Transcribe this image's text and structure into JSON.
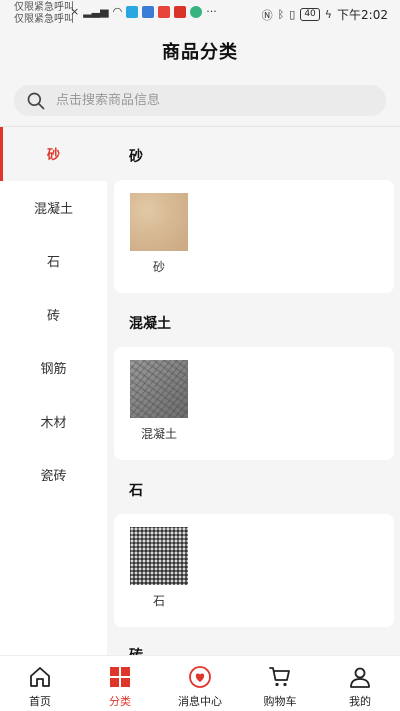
{
  "status_bar": {
    "carrier_line1": "仅限紧急呼叫",
    "carrier_line2": "仅限紧急呼叫",
    "battery": "40",
    "time": "下午2:02"
  },
  "header": {
    "title": "商品分类"
  },
  "search": {
    "placeholder": "点击搜索商品信息"
  },
  "sidebar": {
    "items": [
      {
        "label": "砂",
        "active": true
      },
      {
        "label": "混凝土"
      },
      {
        "label": "石"
      },
      {
        "label": "砖"
      },
      {
        "label": "钢筋"
      },
      {
        "label": "木材"
      },
      {
        "label": "瓷砖"
      }
    ]
  },
  "content": {
    "sections": [
      {
        "title": "砂",
        "products": [
          {
            "name": "砂",
            "image": "sand-photo"
          }
        ]
      },
      {
        "title": "混凝土",
        "products": [
          {
            "name": "混凝土",
            "image": "concrete-photo"
          }
        ]
      },
      {
        "title": "石",
        "products": [
          {
            "name": "石",
            "image": "stone-photo"
          }
        ]
      },
      {
        "title": "砖",
        "products": []
      }
    ]
  },
  "bottom_nav": {
    "items": [
      {
        "label": "首页",
        "icon": "home-icon"
      },
      {
        "label": "分类",
        "icon": "category-icon",
        "active": true
      },
      {
        "label": "消息中心",
        "icon": "message-heart-icon"
      },
      {
        "label": "购物车",
        "icon": "cart-icon"
      },
      {
        "label": "我的",
        "icon": "user-icon"
      }
    ]
  },
  "colors": {
    "accent": "#e0352b",
    "background": "#f5f5f5",
    "text": "#222222"
  }
}
